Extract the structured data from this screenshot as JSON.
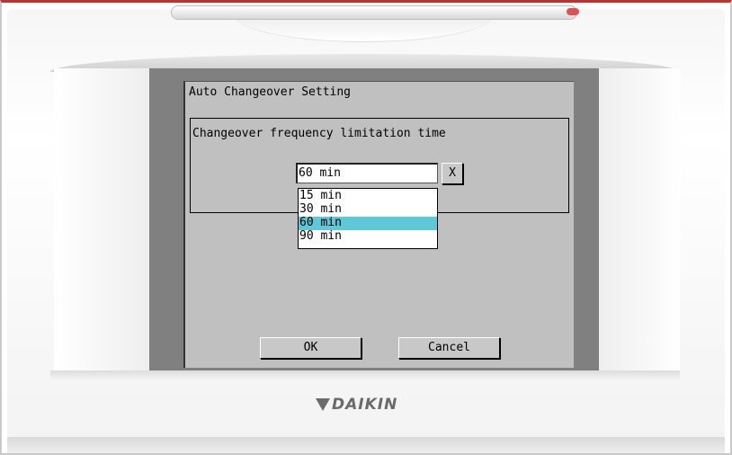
{
  "brand": {
    "logo_text": "DAIKIN"
  },
  "dialog": {
    "title": "Auto Changeover Setting",
    "group_label": "Changeover frequency limitation time",
    "select": {
      "value": "60 min",
      "close_label": "X",
      "options": [
        "15 min",
        "30 min",
        "60 min",
        "90 min"
      ],
      "selected_index": 2,
      "highlight_color": "#5ec8d8"
    },
    "buttons": {
      "ok_label": "OK",
      "cancel_label": "Cancel"
    }
  }
}
